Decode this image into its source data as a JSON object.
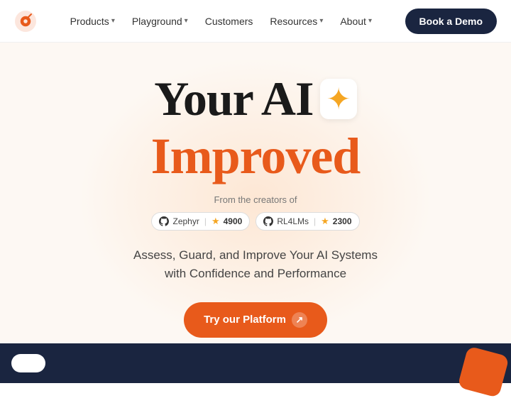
{
  "nav": {
    "logo_alt": "Confident AI logo",
    "links": [
      {
        "label": "Products",
        "has_dropdown": true
      },
      {
        "label": "Playground",
        "has_dropdown": true
      },
      {
        "label": "Customers",
        "has_dropdown": false
      },
      {
        "label": "Resources",
        "has_dropdown": true
      },
      {
        "label": "About",
        "has_dropdown": true
      }
    ],
    "book_demo_label": "Book a Demo"
  },
  "hero": {
    "title_part1": "Your AI",
    "title_part2": "Improved",
    "sparkle": "✦",
    "from_creators": "From the creators of",
    "badge1_name": "Zephyr",
    "badge1_count": "4900",
    "badge2_name": "RL4LMs",
    "badge2_count": "2300",
    "subtitle_line1": "Assess, Guard, and Improve Your AI Systems",
    "subtitle_line2": "with Confidence and Performance",
    "cta_label": "Try our Platform",
    "cta_arrow": "↗"
  }
}
